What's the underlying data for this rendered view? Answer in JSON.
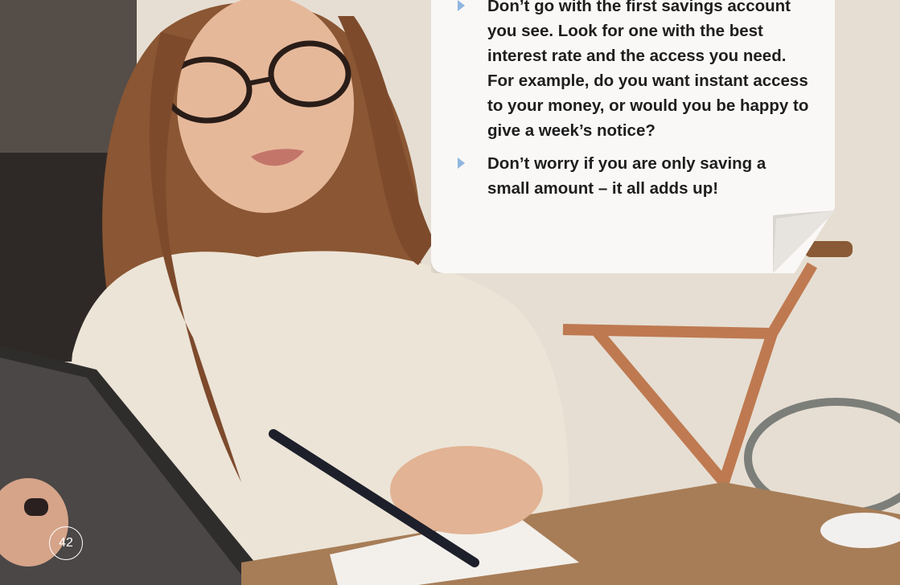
{
  "page": {
    "number": "42",
    "accent_color": "#8fb6df",
    "note_background": "#faf8f6",
    "text_color": "#1e1e1e"
  },
  "tips": {
    "items": [
      {
        "icon": "triangle-bullet-icon",
        "text": "Don’t go with the first savings account you see. Look for one with the best interest rate and the access you need. For example, do you want instant access to your money, or would you be happy to give a week’s notice?"
      },
      {
        "icon": "triangle-bullet-icon",
        "text": "Don’t worry if you are only saving a small amount – it all adds up!"
      }
    ]
  }
}
